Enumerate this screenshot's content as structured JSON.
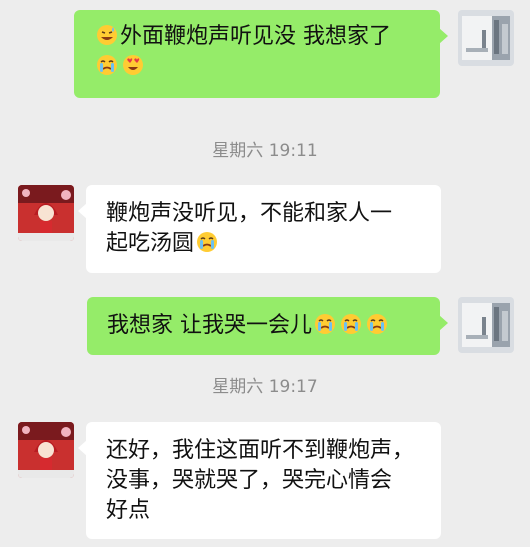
{
  "messages": [
    {
      "text_a": "外面鞭炮声听见没 我想家了",
      "emoji_a": [
        "grinning-sweat-icon"
      ],
      "emoji_b": [
        "crying-icon",
        "heart-eyes-icon"
      ]
    },
    {
      "line1": "鞭炮声没听见，不能和家人一",
      "line2": "起吃汤圆"
    },
    {
      "text": "我想家 让我哭一会儿"
    },
    {
      "line1": "还好，我住这面听不到鞭炮声，",
      "line2": "没事，哭就哭了，哭完心情会",
      "line3": "好点"
    }
  ],
  "timestamps": [
    "星期六 19:11",
    "星期六 19:17"
  ],
  "colors": {
    "background": "#ededed",
    "sent_bubble": "#95ec69",
    "received_bubble": "#ffffff",
    "timestamp_text": "#8c8c8c"
  }
}
